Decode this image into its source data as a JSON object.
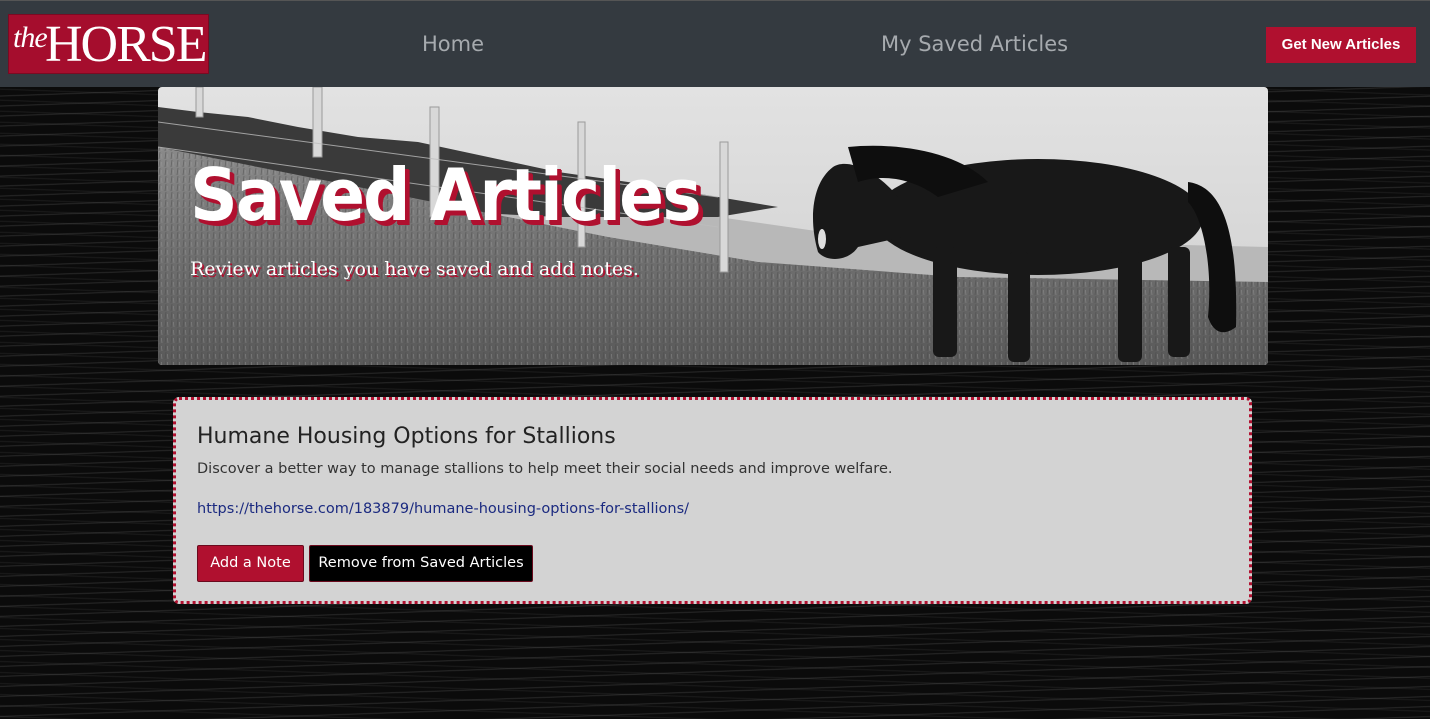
{
  "navbar": {
    "brand": {
      "the": "the",
      "horse": "HORSE"
    },
    "home_label": "Home",
    "saved_label": "My Saved Articles",
    "get_articles_label": "Get New Articles"
  },
  "hero": {
    "title": "Saved Articles",
    "subtitle": "Review articles you have saved and add notes."
  },
  "articles": [
    {
      "title": "Humane Housing Options for Stallions",
      "summary": "Discover a better way to manage stallions to help meet their social needs and improve welfare.",
      "url": "https://thehorse.com/183879/humane-housing-options-for-stallions/",
      "add_note_label": "Add a Note",
      "remove_label": "Remove from Saved Articles"
    }
  ],
  "colors": {
    "accent": "#b0102f",
    "navbar": "#343a40",
    "card": "#d3d3d3"
  }
}
